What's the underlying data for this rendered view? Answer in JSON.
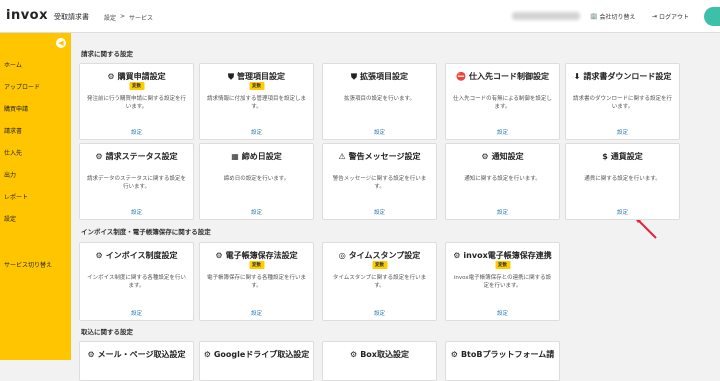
{
  "header": {
    "logo": "invox",
    "logo_sub": "受取請求書",
    "breadcrumb": [
      "設定",
      ">",
      "サービス"
    ],
    "company_switch": "会社切り替え",
    "logout": "ログアウト"
  },
  "sidebar": {
    "items": [
      "ホーム",
      "アップロード",
      "購買申請",
      "請求書",
      "仕入先",
      "出力",
      "レポート",
      "設定",
      "サービス切り替え"
    ]
  },
  "sections": [
    "請求に関する設定",
    "インボイス制度・電子帳簿保存に関する設定",
    "取込に関する設定"
  ],
  "link_label": "設定",
  "cards": [
    {
      "title": "購買申請設定",
      "icon": "⚙",
      "badge": "変数",
      "desc": "発注前に行う購買申請に関する設定を行います。"
    },
    {
      "title": "管理項目設定",
      "icon": "⛊",
      "badge": "変数",
      "desc": "請求情報に付加する管理項目を設定します。"
    },
    {
      "title": "拡張項目設定",
      "icon": "⛊",
      "badge": "",
      "desc": "拡張項目の設定を行います。"
    },
    {
      "title": "仕入先コード制御設定",
      "icon": "⛔",
      "badge": "",
      "desc": "仕入先コードの有無による制御を設定します。"
    },
    {
      "title": "請求書ダウンロード設定",
      "icon": "⬇",
      "badge": "",
      "desc": "請求書のダウンロードに関する設定を行います。"
    },
    {
      "title": "請求ステータス設定",
      "icon": "⚙",
      "badge": "",
      "desc": "請求データのステータスに関する設定を行います。"
    },
    {
      "title": "締め日設定",
      "icon": "▦",
      "badge": "",
      "desc": "締め日の設定を行います。"
    },
    {
      "title": "警告メッセージ設定",
      "icon": "⚠",
      "badge": "",
      "desc": "警告メッセージに関する設定を行います。"
    },
    {
      "title": "通知設定",
      "icon": "⚙",
      "badge": "",
      "desc": "通知に関する設定を行います。"
    },
    {
      "title": "通貨設定",
      "icon": "$",
      "badge": "",
      "desc": "通貨に関する設定を行います。"
    },
    {
      "title": "インボイス制度設定",
      "icon": "⚙",
      "badge": "",
      "desc": "インボイス制度に関する各種設定を行います。"
    },
    {
      "title": "電子帳簿保存法設定",
      "icon": "⚙",
      "badge": "変数",
      "desc": "電子帳簿保存に関する各種設定を行います。"
    },
    {
      "title": "タイムスタンプ設定",
      "icon": "◎",
      "badge": "変数",
      "desc": "タイムスタンプに関する設定を行います。"
    },
    {
      "title": "invox電子帳簿保存連携",
      "icon": "⚙",
      "badge": "変数",
      "desc": "invox電子帳簿保存との連携に関する設定を行います。"
    },
    {
      "title": "メール・ページ取込設定",
      "icon": "⚙",
      "badge": "",
      "desc": ""
    },
    {
      "title": "Googleドライブ取込設定",
      "icon": "⚙",
      "badge": "",
      "desc": ""
    },
    {
      "title": "Box取込設定",
      "icon": "⚙",
      "badge": "",
      "desc": ""
    },
    {
      "title": "BtoBプラットフォーム請",
      "icon": "⚙",
      "badge": "",
      "desc": ""
    }
  ]
}
